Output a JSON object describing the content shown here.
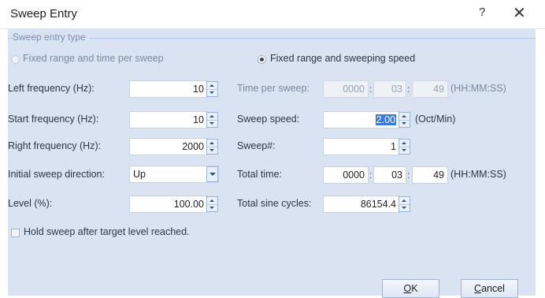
{
  "window": {
    "title": "Sweep Entry",
    "help_glyph": "?",
    "close_glyph": "✕"
  },
  "group": {
    "label": "Sweep entry type"
  },
  "radios": {
    "fixed_time": {
      "label": "Fixed range and time per sweep",
      "checked": false
    },
    "fixed_speed": {
      "label": "Fixed range and sweeping speed",
      "checked": true
    }
  },
  "left": {
    "left_freq": {
      "label": "Left frequency (Hz):",
      "value": "10"
    },
    "start_freq": {
      "label": "Start frequency (Hz):",
      "value": "10"
    },
    "right_freq": {
      "label": "Right frequency (Hz):",
      "value": "2000"
    },
    "direction": {
      "label": "Initial sweep direction:",
      "value": "Up"
    },
    "level": {
      "label": "Level (%):",
      "value": "100.00"
    }
  },
  "right": {
    "time_per_sweep": {
      "label": "Time per sweep:",
      "hh": "0000",
      "mm": "03",
      "ss": "49",
      "unit": "(HH:MM:SS)"
    },
    "sweep_speed": {
      "label": "Sweep speed:",
      "value": "2.00",
      "unit": "(Oct/Min)"
    },
    "sweep_count": {
      "label": "Sweep#:",
      "value": "1"
    },
    "total_time": {
      "label": "Total time:",
      "hh": "0000",
      "mm": "03",
      "ss": "49",
      "unit": "(HH:MM:SS)"
    },
    "total_cycles": {
      "label": "Total sine cycles:",
      "value": "86154.4"
    }
  },
  "hold": {
    "label": "Hold sweep after target level reached.",
    "checked": false
  },
  "buttons": {
    "ok_prefix": "",
    "ok_accel": "O",
    "ok_rest": "K",
    "cancel_accel": "C",
    "cancel_rest": "ancel"
  },
  "colors": {
    "client_bg": "#d9e3f2",
    "selection": "#3b78d8"
  }
}
